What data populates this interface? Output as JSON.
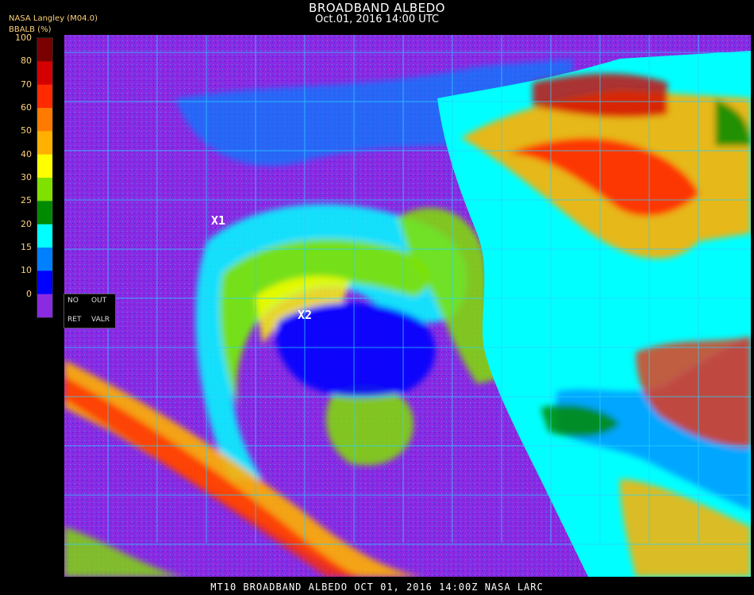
{
  "header": {
    "title": "BROADBAND ALBEDO",
    "subtitle": "Oct.01, 2016 14:00 UTC",
    "source": "NASA Langley (M04.0)",
    "unit": "BBALB (%)"
  },
  "legend": {
    "ticks": [
      "100",
      "80",
      "70",
      "60",
      "50",
      "40",
      "30",
      "25",
      "20",
      "15",
      "10",
      "0"
    ],
    "colors": [
      "#7a0000",
      "#d40000",
      "#ff2a00",
      "#ff7a00",
      "#ffb000",
      "#ffff00",
      "#80e000",
      "#008a00",
      "#00ffff",
      "#0080ff",
      "#0000ff",
      "#8a2be2"
    ]
  },
  "no_retrieval": {
    "no": "NO",
    "out": "OUT",
    "ret": "RET",
    "valr": "VALR"
  },
  "markers": [
    {
      "label": "X1"
    },
    {
      "label": "X2"
    }
  ],
  "footer": "MT10  BROADBAND ALBEDO  OCT 01, 2016 14:00Z  NASA LARC"
}
